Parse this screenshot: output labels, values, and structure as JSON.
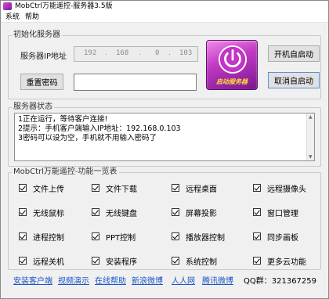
{
  "window": {
    "title": "MobCtrl万能遥控-服务器3.5版"
  },
  "menu": [
    {
      "label": "系统"
    },
    {
      "label": "帮助"
    }
  ],
  "init_group": {
    "legend": "初始化服务器",
    "ip_label": "服务器IP地址",
    "ip_parts": [
      "192",
      "168",
      "0",
      "103"
    ],
    "reset_password_label": "重置密码",
    "password_value": ""
  },
  "power_button": {
    "label": "启动服务器",
    "icon": "power-icon"
  },
  "autostart": {
    "enable_label": "开机自启动",
    "disable_label": "取消自启动"
  },
  "status_group": {
    "legend": "服务器状态",
    "lines": [
      "1正在运行，等待客户连接!",
      "2提示：手机客户端输入IP地址：192.168.0.103",
      "3密码可以设为空，手机就不用输入密码了"
    ]
  },
  "features_group": {
    "legend": "MobCtrl万能遥控-功能一览表",
    "items": [
      {
        "label": "文件上传",
        "checked": true
      },
      {
        "label": "文件下载",
        "checked": true
      },
      {
        "label": "远程桌面",
        "checked": true
      },
      {
        "label": "远程摄像头",
        "checked": true
      },
      {
        "label": "无线鼠标",
        "checked": true
      },
      {
        "label": "无线键盘",
        "checked": true
      },
      {
        "label": "屏幕投影",
        "checked": true
      },
      {
        "label": "窗口管理",
        "checked": true
      },
      {
        "label": "进程控制",
        "checked": true
      },
      {
        "label": "PPT控制",
        "checked": true
      },
      {
        "label": "播放器控制",
        "checked": true
      },
      {
        "label": "同步画板",
        "checked": true
      },
      {
        "label": "远程关机",
        "checked": true
      },
      {
        "label": "安装程序",
        "checked": true
      },
      {
        "label": "系统控制",
        "checked": true
      },
      {
        "label": "更多云功能",
        "checked": true
      }
    ]
  },
  "footer": {
    "links": [
      "安装客户端",
      "视频演示",
      "在线帮助",
      "新浪微博",
      "人人网",
      "腾讯微博"
    ],
    "qq_label": "QQ群：",
    "qq_number": "321367259"
  },
  "colors": {
    "link": "#1a56c9",
    "power_gradient_top": "#f08ae9",
    "power_gradient_bottom": "#7b158f",
    "power_label": "#ffdd33"
  }
}
